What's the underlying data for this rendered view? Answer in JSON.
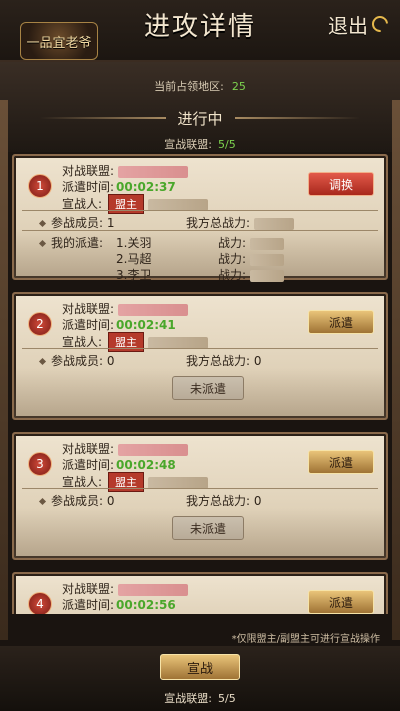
{
  "logo_text": "一品宜老爷",
  "title": "进攻详情",
  "exit_label": "退出",
  "occupy": {
    "label": "当前占领地区:",
    "value": "25"
  },
  "status": "进行中",
  "declared": {
    "label": "宣战联盟:",
    "value": "5/5"
  },
  "labels": {
    "alliance": "对战联盟:",
    "dispatch_time": "派遣时间:",
    "declarer": "宣战人:",
    "leader_tag": "盟主",
    "members": "参战成员:",
    "total_power": "我方总战力:",
    "my_dispatch": "我的派遣:",
    "power": "战力:",
    "undispatched": "未派遣"
  },
  "cards": [
    {
      "index": "1",
      "time": "00:02:37",
      "button": "调换",
      "members": "1",
      "dispatch": [
        "1.关羽",
        "2.马超",
        "3.李卫"
      ]
    },
    {
      "index": "2",
      "time": "00:02:41",
      "button": "派遣",
      "members": "0",
      "total_power": "0"
    },
    {
      "index": "3",
      "time": "00:02:48",
      "button": "派遣",
      "members": "0",
      "total_power": "0"
    },
    {
      "index": "4",
      "time": "00:02:56",
      "button": "派遣"
    }
  ],
  "notice": "*仅限盟主/副盟主可进行宣战操作",
  "declare_button": "宣战",
  "bottom_declared": {
    "label": "宣战联盟:",
    "value": "5/5"
  }
}
